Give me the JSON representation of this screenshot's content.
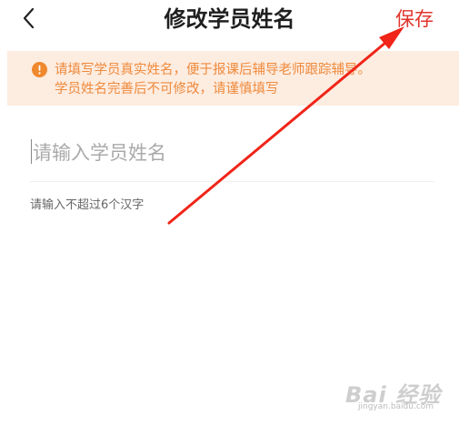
{
  "header": {
    "title": "修改学员姓名",
    "save_label": "保存"
  },
  "notice": {
    "line1": "请填写学员真实姓名，便于报课后辅导老师跟踪辅导。",
    "line2": "学员姓名完善后不可修改，请谨慎填写"
  },
  "form": {
    "name_input": {
      "value": "",
      "placeholder": "请输入学员姓名"
    },
    "hint": "请输入不超过6个汉字"
  },
  "watermark": {
    "logo_text": "Bai 经验",
    "site": "jingyan.baidu.com"
  },
  "colors": {
    "accent": "#e0342c",
    "notice_bg": "#fdece0",
    "notice_text": "#ef8a3c",
    "arrow": "#f02418"
  },
  "icons": {
    "back": "chevron-left-icon",
    "notice": "warning-circle-icon",
    "annotation": "red-arrow-annotation"
  }
}
